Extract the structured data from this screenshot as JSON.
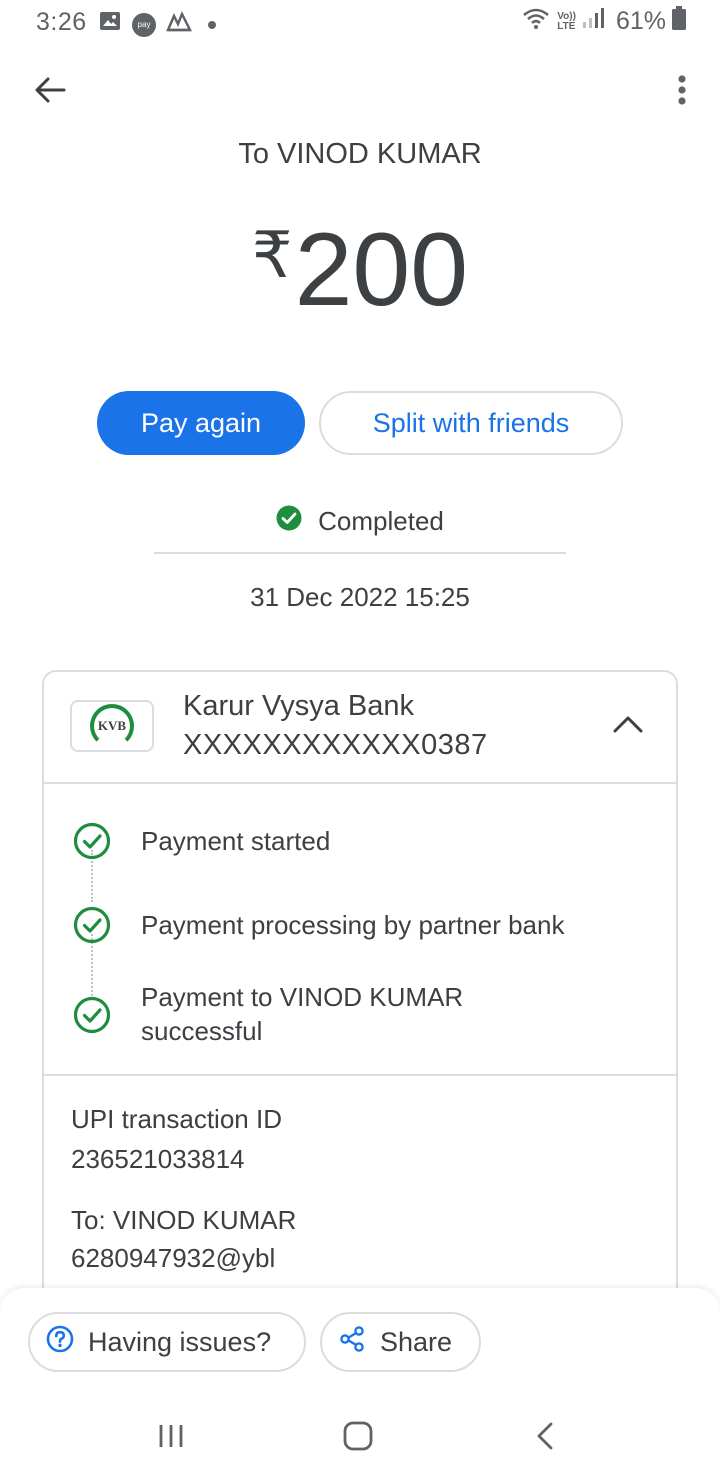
{
  "status_bar": {
    "time": "3:26",
    "battery_percent": "61%",
    "left_icons": [
      "gallery-icon",
      "paytm-icon",
      "vodafone-icon",
      "dot-icon"
    ],
    "right_icons": [
      "wifi-icon",
      "volte-icon",
      "signal-icon",
      "battery-icon"
    ],
    "volte_text_top": "Vo))",
    "volte_text_bottom": "LTE",
    "paytm_text": "pay"
  },
  "header": {
    "back_icon": "arrow-left-icon",
    "more_icon": "more-vert-icon"
  },
  "transaction": {
    "recipient_title": "To VINOD KUMAR",
    "currency_symbol": "₹",
    "amount": "200",
    "status": "Completed",
    "date": "31 Dec 2022 15:25"
  },
  "actions": {
    "pay_again": "Pay again",
    "split": "Split with friends"
  },
  "bank": {
    "logo_text": "KVB",
    "name": "Karur Vysya Bank",
    "account": "XXXXXXXXXXXX0387"
  },
  "steps": [
    {
      "line1": "Payment started",
      "line2": ""
    },
    {
      "line1": "Payment processing by partner bank",
      "line2": ""
    },
    {
      "line1": "Payment to VINOD KUMAR",
      "line2": "successful"
    }
  ],
  "details": {
    "upi_label": "UPI transaction ID",
    "upi_value": "236521033814",
    "to_label": "To: VINOD KUMAR",
    "to_value": "6280947932@ybl"
  },
  "bottom_actions": {
    "issues": "Having issues?",
    "share": "Share"
  },
  "colors": {
    "accent": "#1a73e8",
    "success": "#1e8e3e",
    "text": "#3c4043",
    "border": "#dadce0"
  }
}
